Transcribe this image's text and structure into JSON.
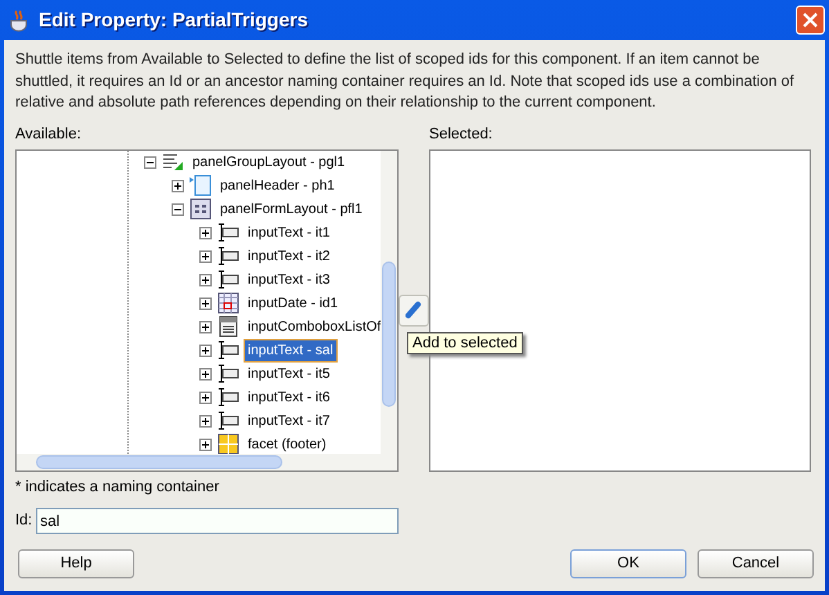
{
  "window": {
    "title": "Edit Property: PartialTriggers"
  },
  "description": "Shuttle items from Available to Selected to define the list of scoped ids for this component. If an item cannot be shuttled, it requires an Id or an ancestor naming container requires an Id. Note that scoped ids use a combination of relative and absolute path references depending on their relationship to the current component.",
  "available": {
    "label": "Available:",
    "tree": [
      {
        "label": "panelGroupLayout - pgl1",
        "kind": "group",
        "expanded": true,
        "selected": false,
        "children": [
          {
            "label": "panelHeader - ph1",
            "kind": "header",
            "expanded": false,
            "selected": false
          },
          {
            "label": "panelFormLayout - pfl1",
            "kind": "form",
            "expanded": true,
            "selected": false,
            "children": [
              {
                "label": "inputText - it1",
                "kind": "text",
                "expanded": false,
                "selected": false
              },
              {
                "label": "inputText - it2",
                "kind": "text",
                "expanded": false,
                "selected": false
              },
              {
                "label": "inputText - it3",
                "kind": "text",
                "expanded": false,
                "selected": false
              },
              {
                "label": "inputDate - id1",
                "kind": "date",
                "expanded": false,
                "selected": false
              },
              {
                "label": "inputComboboxListOf",
                "kind": "combo",
                "expanded": false,
                "selected": false
              },
              {
                "label": "inputText - sal",
                "kind": "text",
                "expanded": false,
                "selected": true
              },
              {
                "label": "inputText - it5",
                "kind": "text",
                "expanded": false,
                "selected": false
              },
              {
                "label": "inputText - it6",
                "kind": "text",
                "expanded": false,
                "selected": false
              },
              {
                "label": "inputText - it7",
                "kind": "text",
                "expanded": false,
                "selected": false
              },
              {
                "label": "facet (footer)",
                "kind": "facet",
                "expanded": false,
                "selected": false
              }
            ]
          }
        ]
      }
    ]
  },
  "tooltip": "Add to selected",
  "selected": {
    "label": "Selected:"
  },
  "footnote": "* indicates a naming container",
  "id_field": {
    "label": "Id:",
    "value": "sal"
  },
  "buttons": [
    "Help",
    "OK",
    "Cancel"
  ]
}
